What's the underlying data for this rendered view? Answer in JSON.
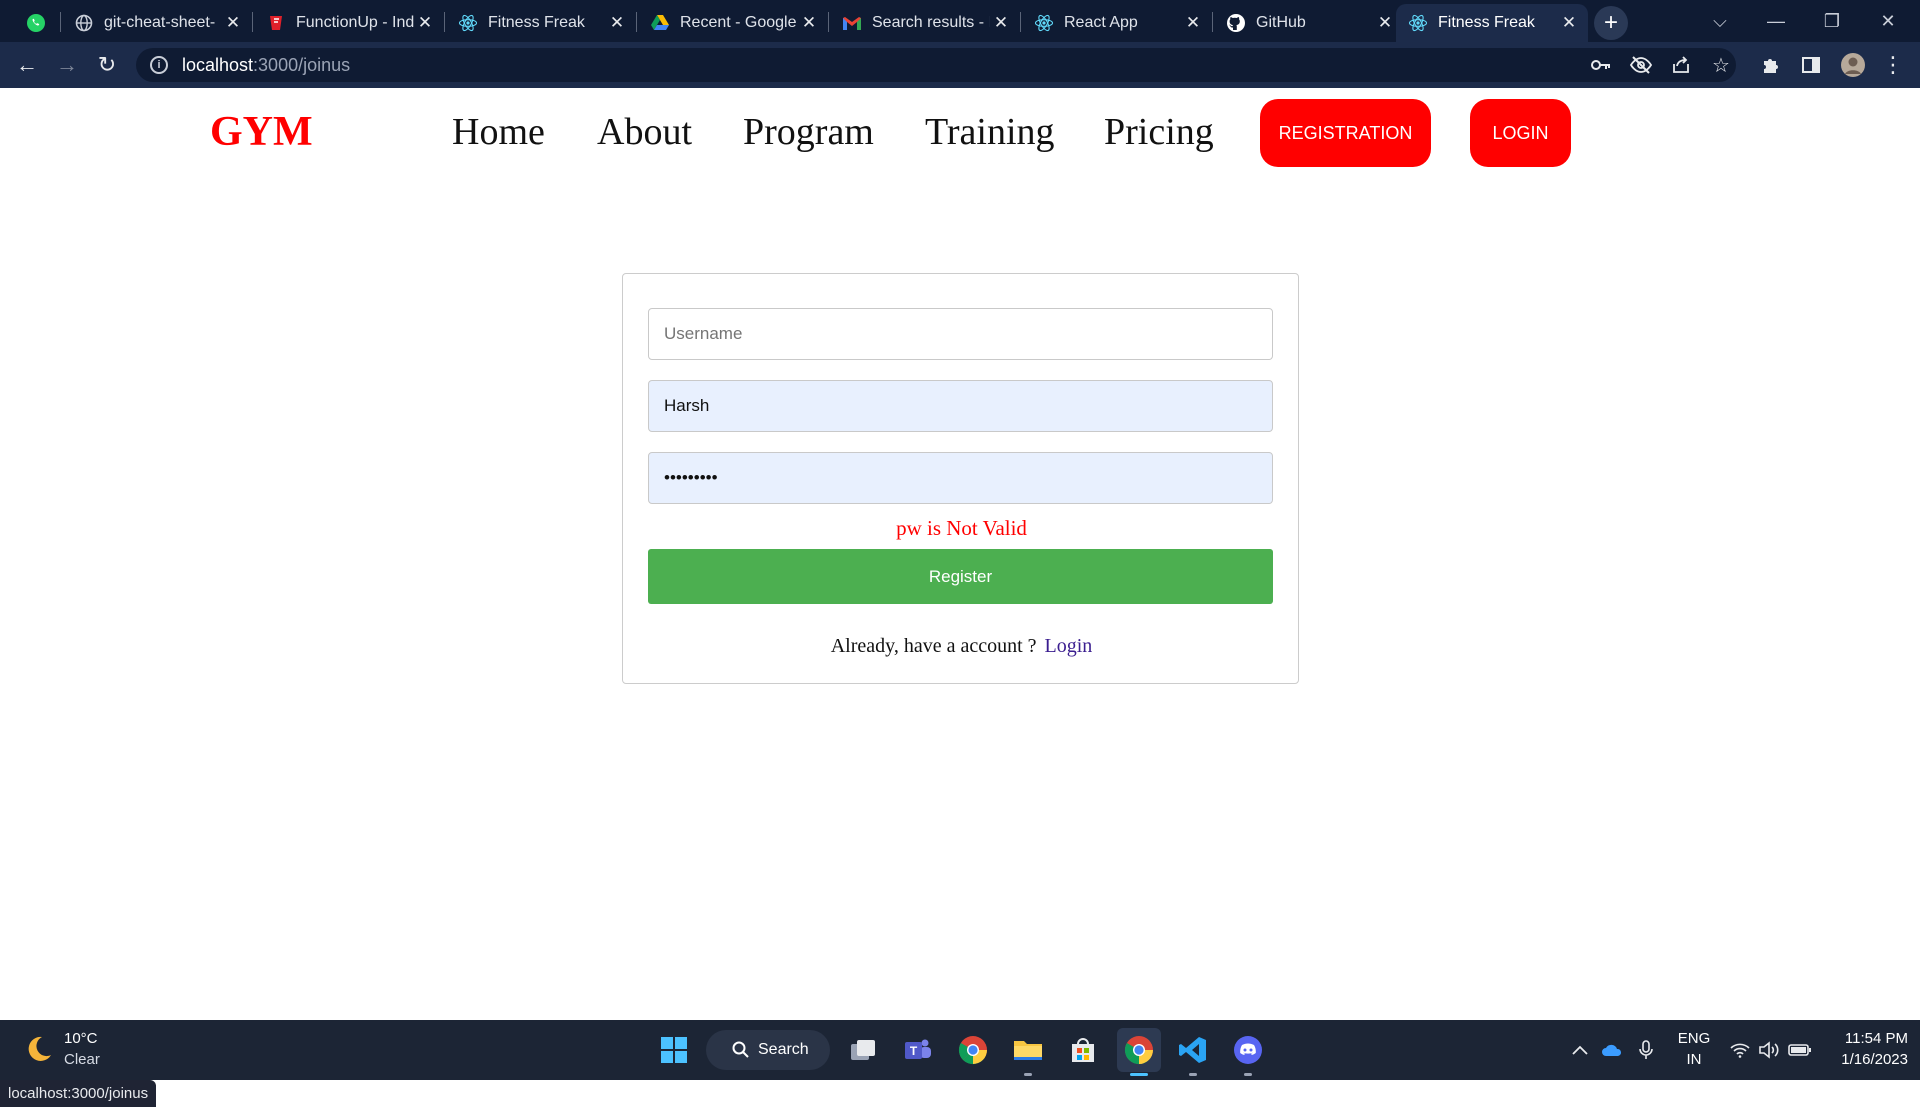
{
  "browser": {
    "tabs": [
      {
        "title": "",
        "icon": "whatsapp-icon"
      },
      {
        "title": "git-cheat-sheet-",
        "icon": "globe-icon"
      },
      {
        "title": "FunctionUp - Ind",
        "icon": "functionup-icon"
      },
      {
        "title": "Fitness Freak",
        "icon": "react-icon"
      },
      {
        "title": "Recent - Google",
        "icon": "google-drive-icon"
      },
      {
        "title": "Search results - I",
        "icon": "gmail-icon"
      },
      {
        "title": "React App",
        "icon": "react-icon"
      },
      {
        "title": "GitHub",
        "icon": "github-icon"
      },
      {
        "title": "Fitness Freak",
        "icon": "react-icon",
        "active": true
      }
    ],
    "address": {
      "host": "localhost",
      "path": ":3000/joinus"
    },
    "status_url": "localhost:3000/joinus"
  },
  "site": {
    "brand": "GYM",
    "nav": [
      "Home",
      "About",
      "Program",
      "Training",
      "Pricing"
    ],
    "registration_label": "REGISTRATION",
    "login_label": "LOGIN",
    "accent": "#ff0000"
  },
  "form": {
    "username_placeholder": "Username",
    "name_value": "Harsh",
    "password_value": "•••••••••",
    "error": "pw is Not Valid",
    "error_color": "#ff0000",
    "register_label": "Register",
    "register_color": "#4caf50",
    "already_text": "Already, have a account ?",
    "login_link": "Login"
  },
  "taskbar": {
    "temperature": "10°C",
    "condition": "Clear",
    "search_label": "Search",
    "language": "ENG",
    "region": "IN",
    "time": "11:54 PM",
    "date": "1/16/2023"
  }
}
